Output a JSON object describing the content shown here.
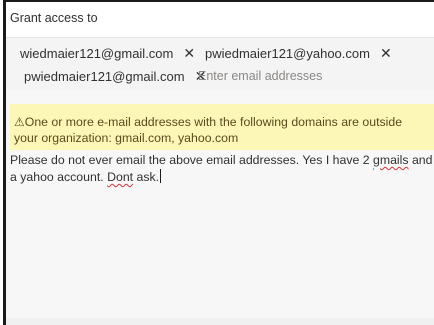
{
  "header": {
    "title": "Grant access to"
  },
  "recipients": {
    "chips": [
      {
        "email": "wiedmaier121@gmail.com",
        "remove": "✕"
      },
      {
        "email": "pwiedmaier121@yahoo.com",
        "remove": "✕"
      },
      {
        "email": "pwiedmaier121@gmail.com",
        "remove": "✕"
      }
    ],
    "input_placeholder": "Enter email addresses"
  },
  "warning": {
    "icon": "warning-icon",
    "text": "One or more e-mail addresses with the following domains are outside your organization: gmail.com, yahoo.com"
  },
  "message": {
    "part1": "Please do not ever email the above email addresses. Yes I have 2 ",
    "word_gmails": "gmails",
    "part2": " and a yahoo account. ",
    "word_dont": "Dont",
    "part3": " ask."
  },
  "colors": {
    "warning_bg": "#fcf7b6",
    "spellcheck": "#d13438"
  }
}
